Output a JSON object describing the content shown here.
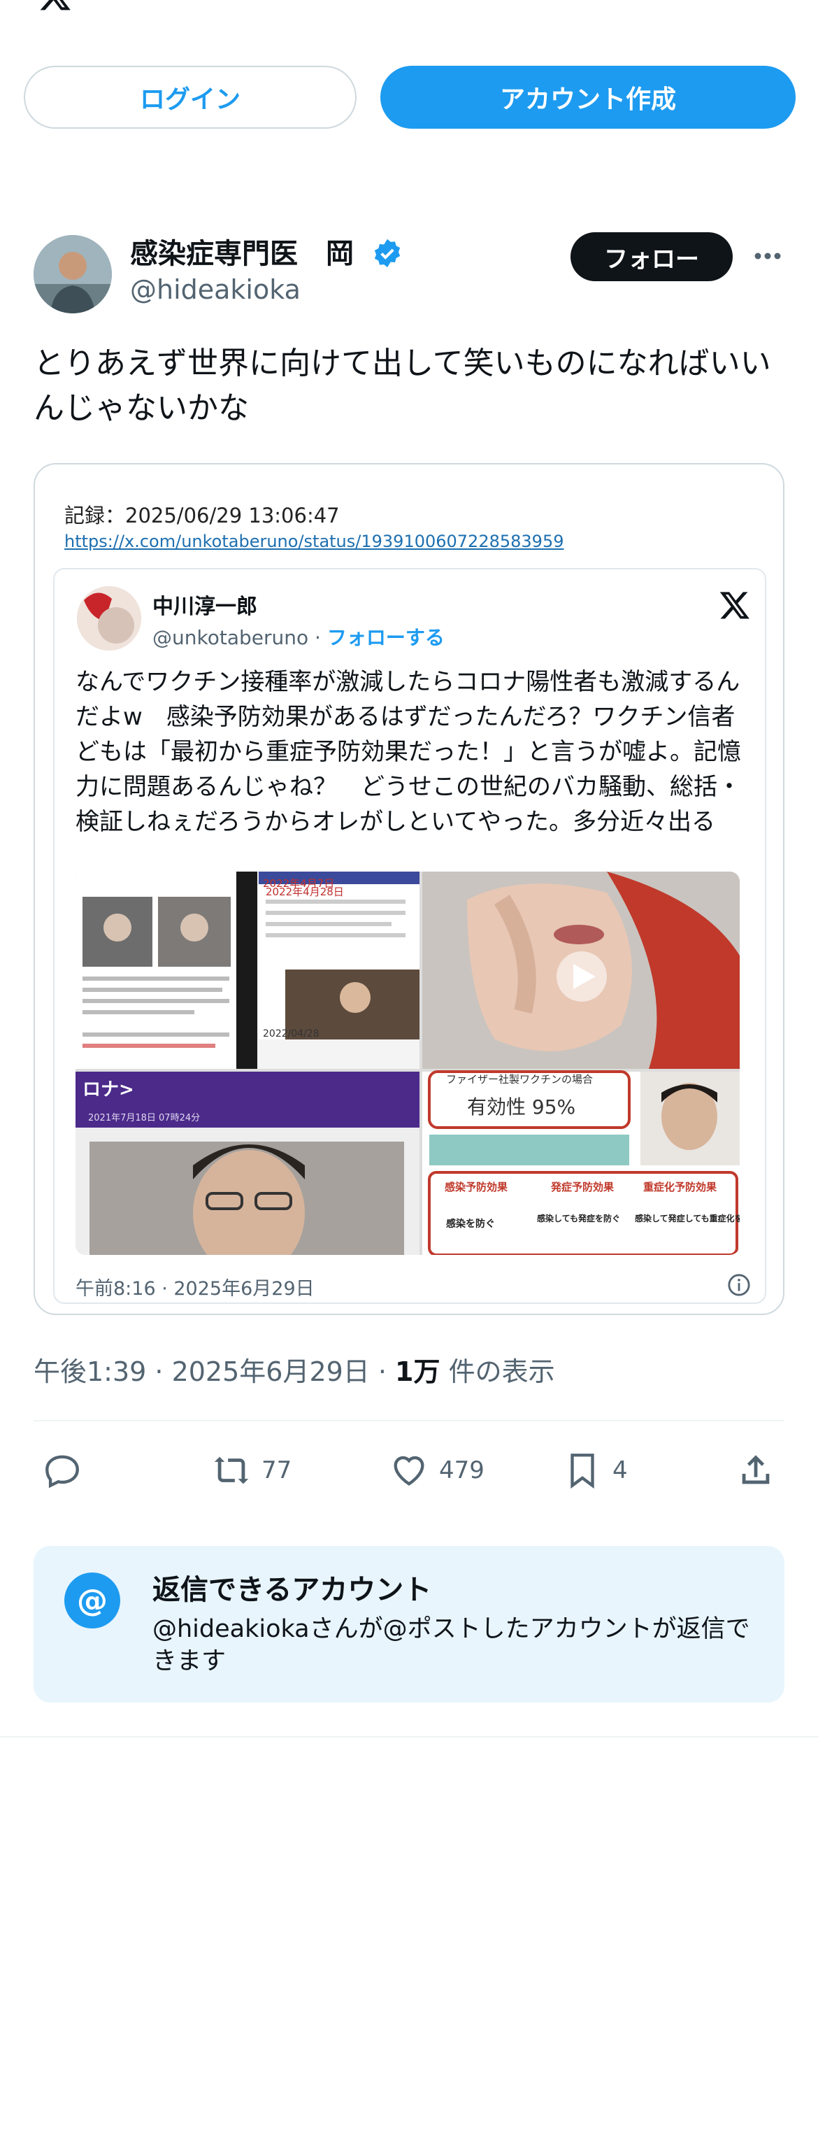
{
  "header": {
    "login_label": "ログイン",
    "signup_label": "アカウント作成"
  },
  "tweet": {
    "author_name": "感染症専門医　岡",
    "author_handle": "@hideakioka",
    "follow_label": "フォロー",
    "text": "とりあえず世界に向けて出して笑いものになればいいんじゃないかな",
    "timestamp": "午後1:39 · 2025年6月29日 · ",
    "views_count": "1万",
    "views_label": " 件の表示"
  },
  "embed": {
    "record_label": "記録：2025/06/29 13:06:47",
    "record_url": "https://x.com/unkotaberuno/status/1939100607228583959",
    "inner": {
      "name": "中川淳一郎",
      "handle": "@unkotaberuno · ",
      "follow_label": "フォローする",
      "text": "なんでワクチン接種率が激減したらコロナ陽性者も激減するんだよw　感染予防効果があるはずだったんだろ？ワクチン信者どもは「最初から重症予防効果だった！」と言うが嘘よ。記憶力に問題あるんじゃね？　どうせこの世紀のバカ騒動、総括・検証しねぇだろうからオレがしといてやった。多分近々出る",
      "time": "午前8:16 · 2025年6月29日",
      "media": {
        "date1": "2022年4月7日",
        "date2": "2022年4月28日",
        "date3": "2022/04/28",
        "banner": "ロナ>",
        "banner_date": "2021年7月18日 07時24分",
        "pfizer_title": "ファイザー社製ワクチンの場合",
        "efficacy": "有効性 95%",
        "effect1": "感染予防効果",
        "effect1_sub": "感染を防ぐ",
        "effect2": "発症予防効果",
        "effect2_sub": "感染しても発症を防ぐ",
        "effect3": "重症化予防効果",
        "effect3_sub": "感染して発症しても重症化を防ぐ"
      }
    }
  },
  "actions": {
    "retweets": "77",
    "likes": "479",
    "bookmarks": "4"
  },
  "reply_info": {
    "title": "返信できるアカウント",
    "desc": "@hideakiokaさんが@ポストしたアカウントが返信できます"
  },
  "colors": {
    "accent": "#1d9bf0",
    "text": "#0f1419",
    "muted": "#536471",
    "reply_bg": "#e8f5fd"
  }
}
